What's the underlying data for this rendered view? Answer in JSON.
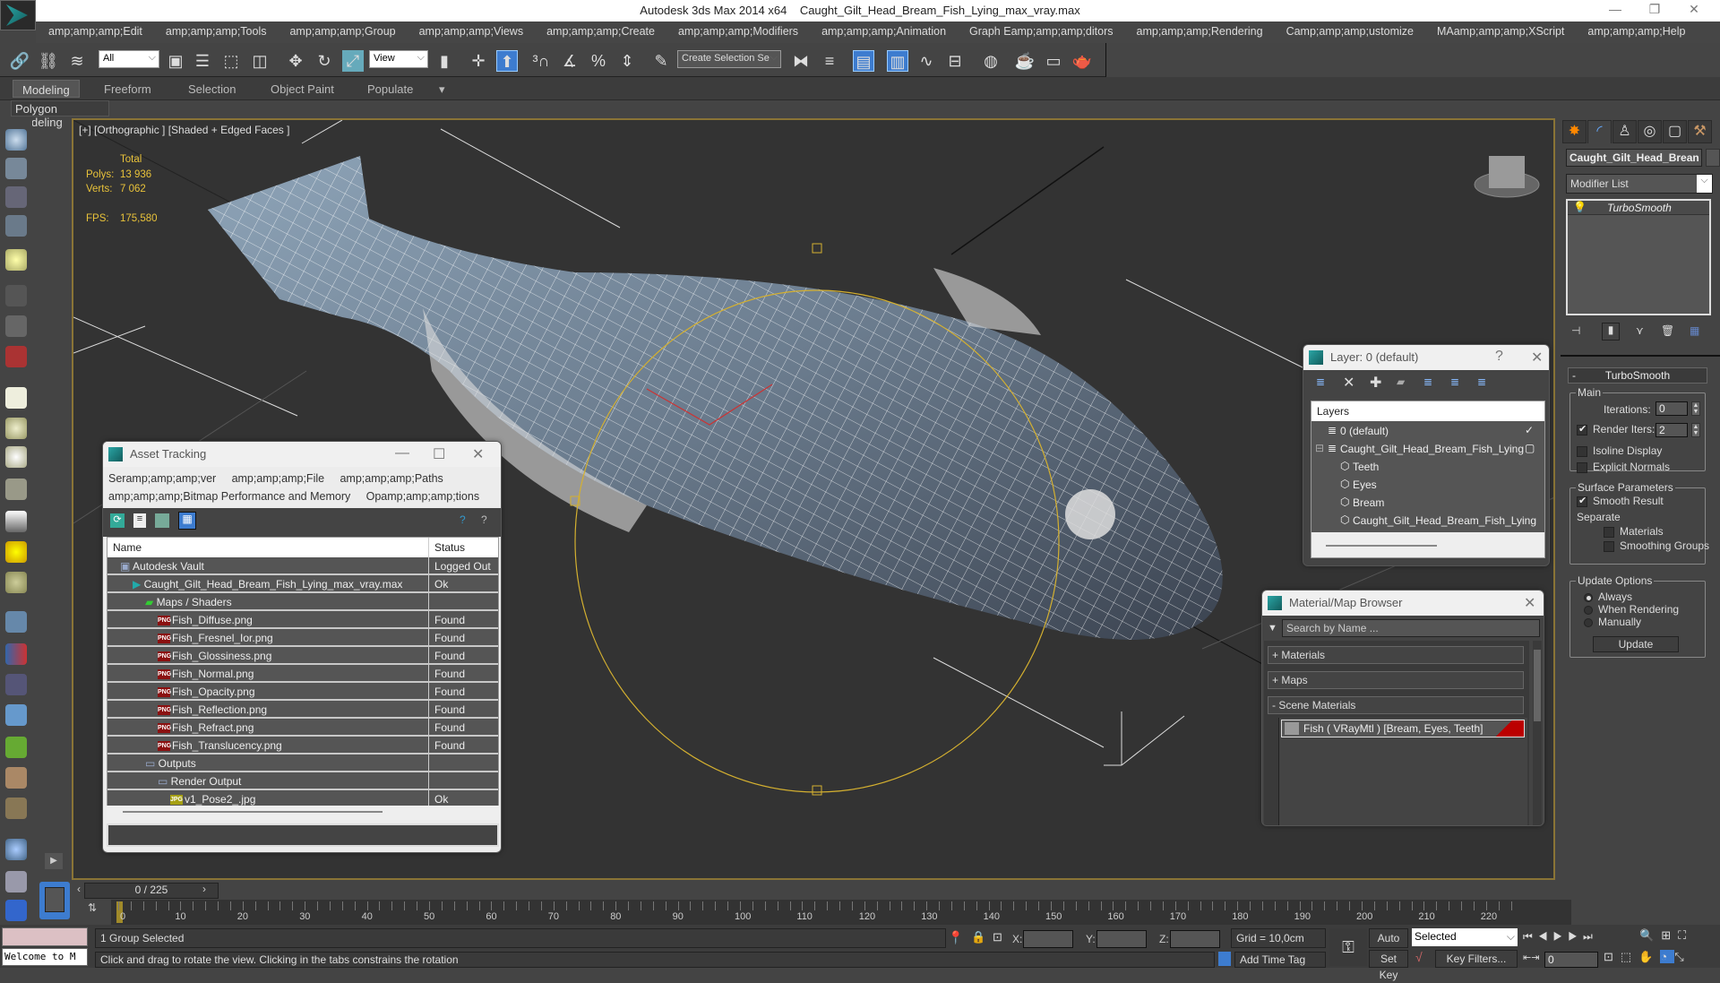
{
  "window": {
    "app_title": "Autodesk 3ds Max  2014 x64",
    "file_title": "Caught_Gilt_Head_Bream_Fish_Lying_max_vray.max",
    "minimize": "—",
    "restore": "❐",
    "close": "✕"
  },
  "menu": [
    "amp;amp;amp;Edit",
    "amp;amp;amp;Tools",
    "amp;amp;amp;Group",
    "amp;amp;amp;Views",
    "amp;amp;amp;Create",
    "amp;amp;amp;Modifiers",
    "amp;amp;amp;Animation",
    "Graph Eamp;amp;amp;ditors",
    "amp;amp;amp;Rendering",
    "Camp;amp;amp;ustomize",
    "MAamp;amp;amp;XScript",
    "amp;amp;amp;Help"
  ],
  "toolbar": {
    "selection_filter": "All",
    "ref_coord": "View",
    "named_selection": "Create Selection Se"
  },
  "ribbon": {
    "tabs": [
      "Modeling",
      "Freeform",
      "Selection",
      "Object Paint",
      "Populate"
    ],
    "active_tab": "Modeling",
    "sub_label": "Polygon Modeling"
  },
  "viewport": {
    "label": "[+] [Orthographic ] [Shaded + Edged Faces ]",
    "stats": {
      "total_label": "Total",
      "polys_label": "Polys:",
      "polys_value": "13 936",
      "verts_label": "Verts:",
      "verts_value": "7 062",
      "fps_label": "FPS:",
      "fps_value": "175,580"
    }
  },
  "command_panel": {
    "object_name": "Caught_Gilt_Head_Brean",
    "modifier_list": "Modifier List",
    "stack": [
      "TurboSmooth"
    ],
    "rollout_title": "TurboSmooth",
    "main_group": "Main",
    "iterations_label": "Iterations:",
    "iterations_value": "0",
    "render_iters_label": "Render Iters:",
    "render_iters_value": "2",
    "render_iters_checked": true,
    "isoline_label": "Isoline Display",
    "explicit_normals_label": "Explicit Normals",
    "surface_group": "Surface Parameters",
    "smooth_result_label": "Smooth Result",
    "separate_label": "Separate",
    "materials_label": "Materials",
    "smoothing_groups_label": "Smoothing Groups",
    "update_group": "Update Options",
    "always_label": "Always",
    "when_rendering_label": "When Rendering",
    "manually_label": "Manually",
    "update_button": "Update"
  },
  "asset_tracking": {
    "title": "Asset Tracking",
    "menu_row1": [
      "Seramp;amp;amp;ver",
      "amp;amp;amp;File",
      "amp;amp;amp;Paths"
    ],
    "menu_row2": [
      "amp;amp;amp;Bitmap Performance and Memory",
      "Opamp;amp;amp;tions"
    ],
    "col_name": "Name",
    "col_status": "Status",
    "rows": [
      {
        "name": "Autodesk Vault",
        "status": "Logged Out ..",
        "indent": 1,
        "icon": "vault"
      },
      {
        "name": "Caught_Gilt_Head_Bream_Fish_Lying_max_vray.max",
        "status": "Ok",
        "indent": 2,
        "icon": "max"
      },
      {
        "name": "Maps / Shaders",
        "status": "",
        "indent": 3,
        "icon": "maps"
      },
      {
        "name": "Fish_Diffuse.png",
        "status": "Found",
        "indent": 4,
        "icon": "png"
      },
      {
        "name": "Fish_Fresnel_Ior.png",
        "status": "Found",
        "indent": 4,
        "icon": "png"
      },
      {
        "name": "Fish_Glossiness.png",
        "status": "Found",
        "indent": 4,
        "icon": "png"
      },
      {
        "name": "Fish_Normal.png",
        "status": "Found",
        "indent": 4,
        "icon": "png"
      },
      {
        "name": "Fish_Opacity.png",
        "status": "Found",
        "indent": 4,
        "icon": "png"
      },
      {
        "name": "Fish_Reflection.png",
        "status": "Found",
        "indent": 4,
        "icon": "png"
      },
      {
        "name": "Fish_Refract.png",
        "status": "Found",
        "indent": 4,
        "icon": "png"
      },
      {
        "name": "Fish_Translucency.png",
        "status": "Found",
        "indent": 4,
        "icon": "png"
      },
      {
        "name": "Outputs",
        "status": "",
        "indent": 3,
        "icon": "output"
      },
      {
        "name": "Render Output",
        "status": "",
        "indent": 4,
        "icon": "output"
      },
      {
        "name": "v1_Pose2_.jpg",
        "status": "Ok",
        "indent": 5,
        "icon": "jpg"
      }
    ]
  },
  "layer_dialog": {
    "title": "Layer: 0 (default)",
    "help": "?",
    "header": "Layers",
    "rows": [
      {
        "name": "0 (default)",
        "indent": 1,
        "type": "layer",
        "flag": "✓"
      },
      {
        "name": "Caught_Gilt_Head_Bream_Fish_Lying",
        "indent": 1,
        "type": "layer",
        "flag": "▢",
        "expander": "⊟"
      },
      {
        "name": "Teeth",
        "indent": 2,
        "type": "object"
      },
      {
        "name": "Eyes",
        "indent": 2,
        "type": "object"
      },
      {
        "name": "Bream",
        "indent": 2,
        "type": "object"
      },
      {
        "name": "Caught_Gilt_Head_Bream_Fish_Lying",
        "indent": 2,
        "type": "object"
      }
    ]
  },
  "material_browser": {
    "title": "Material/Map Browser",
    "search_placeholder": "Search by Name ...",
    "sections": [
      "+ Materials",
      "+ Maps",
      "- Scene Materials"
    ],
    "scene_material": "Fish  ( VRayMtl )  [Bream, Eyes, Teeth]"
  },
  "timeline": {
    "frame_display": "0 / 225",
    "ticks": [
      "0",
      "10",
      "20",
      "30",
      "40",
      "50",
      "60",
      "70",
      "80",
      "90",
      "100",
      "110",
      "120",
      "130",
      "140",
      "150",
      "160",
      "170",
      "180",
      "190",
      "200",
      "210",
      "220"
    ]
  },
  "status": {
    "selection": "1 Group Selected",
    "prompt": "Click and drag to rotate the view.  Clicking in the tabs constrains the rotation",
    "maxscript": "Welcome to M",
    "x_label": "X:",
    "y_label": "Y:",
    "z_label": "Z:",
    "grid": "Grid = 10,0cm",
    "add_time_tag": "Add Time Tag",
    "auto_key": "Auto Key",
    "set_key": "Set Key",
    "key_mode": "Selected",
    "key_filters": "Key Filters...",
    "current_frame": "0"
  }
}
